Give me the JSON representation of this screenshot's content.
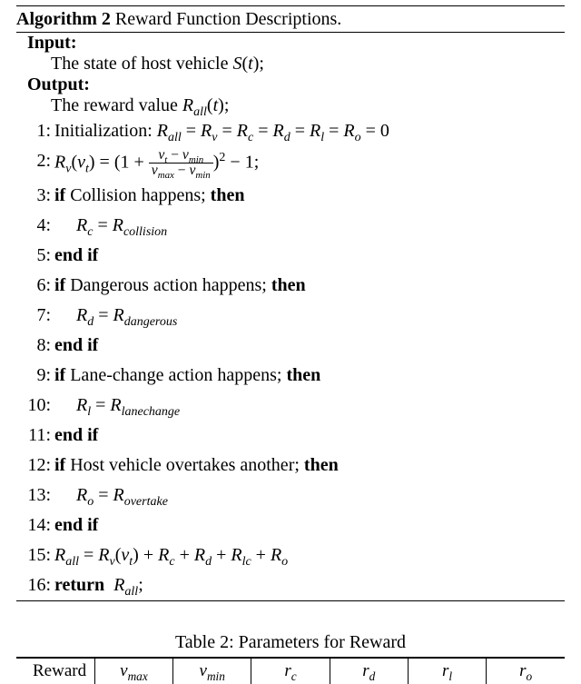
{
  "algorithm": {
    "label": "Algorithm 2",
    "title": "Reward Function Descriptions.",
    "input_head": "Input:",
    "input_text_pre": "The state of host vehicle ",
    "input_sym_S": "S",
    "input_sym_t": "t",
    "input_text_post": ";",
    "output_head": "Output:",
    "output_text_pre": "The reward value ",
    "output_sym_R": "R",
    "output_sub_all": "all",
    "output_sym_t": "t",
    "output_text_post": ";",
    "lines": {
      "l1_pre": "Initialization: ",
      "l1_eq": "R_all = R_v = R_c = R_d = R_l = R_o = 0",
      "l2_lhs": "R_v(v_t) = ",
      "l2_num": "v_t − v_min",
      "l2_den": "v_max − v_min",
      "l3": "Collision happens; ",
      "l4": "R_c = R_collision",
      "l6": "Dangerous action happens; ",
      "l7": "R_d = R_dangerous",
      "l9": "Lane-change action happens; ",
      "l10": "R_l = R_lanechange",
      "l12": "Host vehicle overtakes another; ",
      "l13": "R_o = R_overtake",
      "l15": "R_all = R_v(v_t) + R_c + R_d + R_lc + R_o",
      "l16_ret": "R_all"
    },
    "kw": {
      "if": "if",
      "then": "then",
      "endif": "end if",
      "return": "return"
    }
  },
  "table": {
    "caption": "Table 2: Parameters for Reward",
    "headers": [
      "Reward",
      "v_max",
      "v_min",
      "r_c",
      "r_d",
      "r_l",
      "r_o"
    ]
  }
}
